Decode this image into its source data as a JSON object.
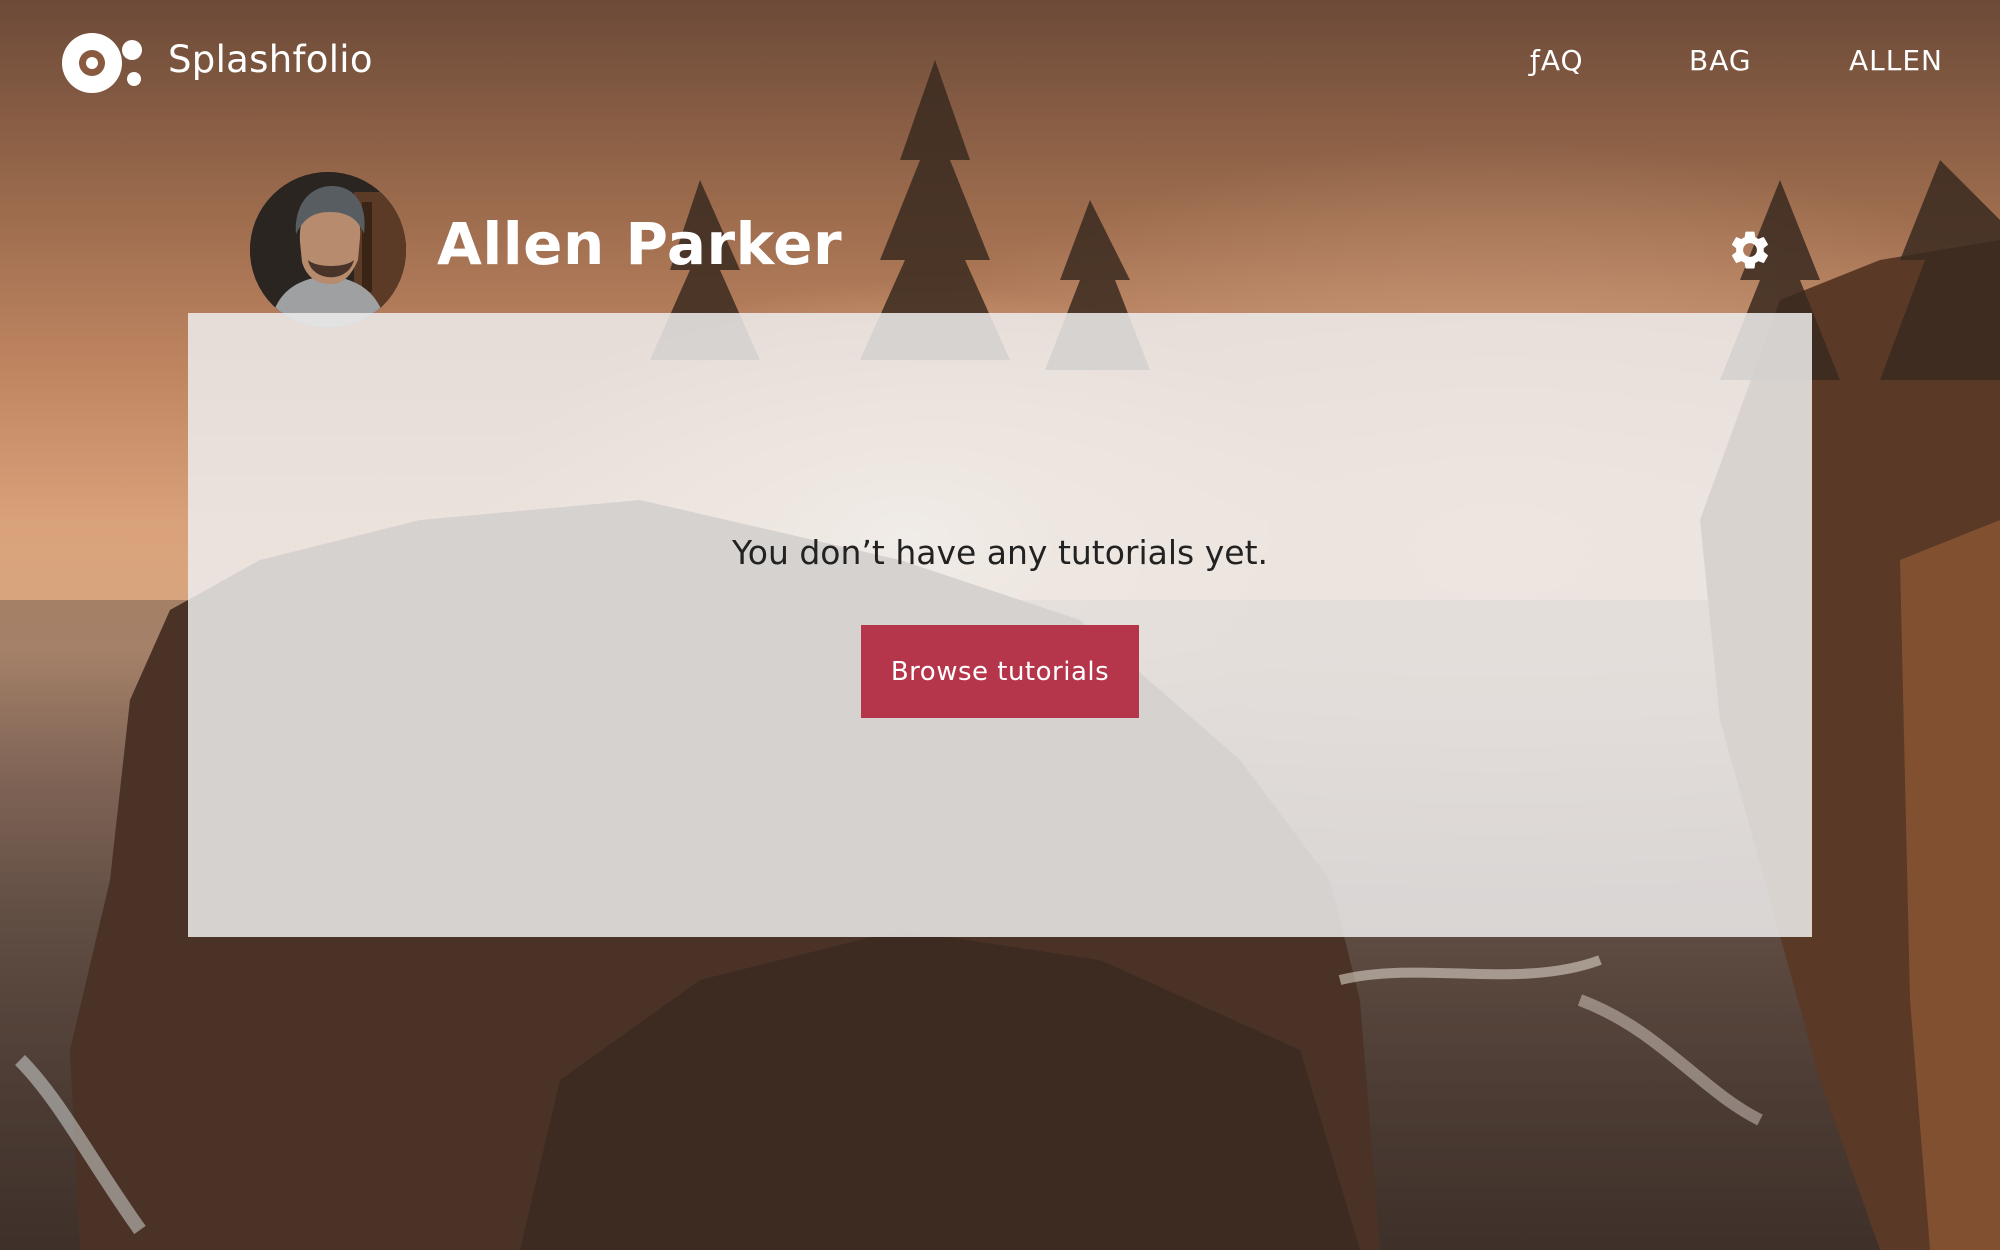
{
  "brand": {
    "name": "Splashfolio"
  },
  "nav": {
    "faq": "ƒAQ",
    "bag": "BAG",
    "user": "ALLEN"
  },
  "profile": {
    "name": "Allen Parker",
    "avatar_icon": "user-avatar-photo",
    "settings_icon": "gear-icon"
  },
  "empty_state": {
    "message": "You don’t have any tutorials yet.",
    "button_label": "Browse tutorials"
  },
  "colors": {
    "accent": "#b5364b",
    "panel": "#eeecec",
    "text_light": "#ffffff",
    "text_dark": "#222222"
  }
}
